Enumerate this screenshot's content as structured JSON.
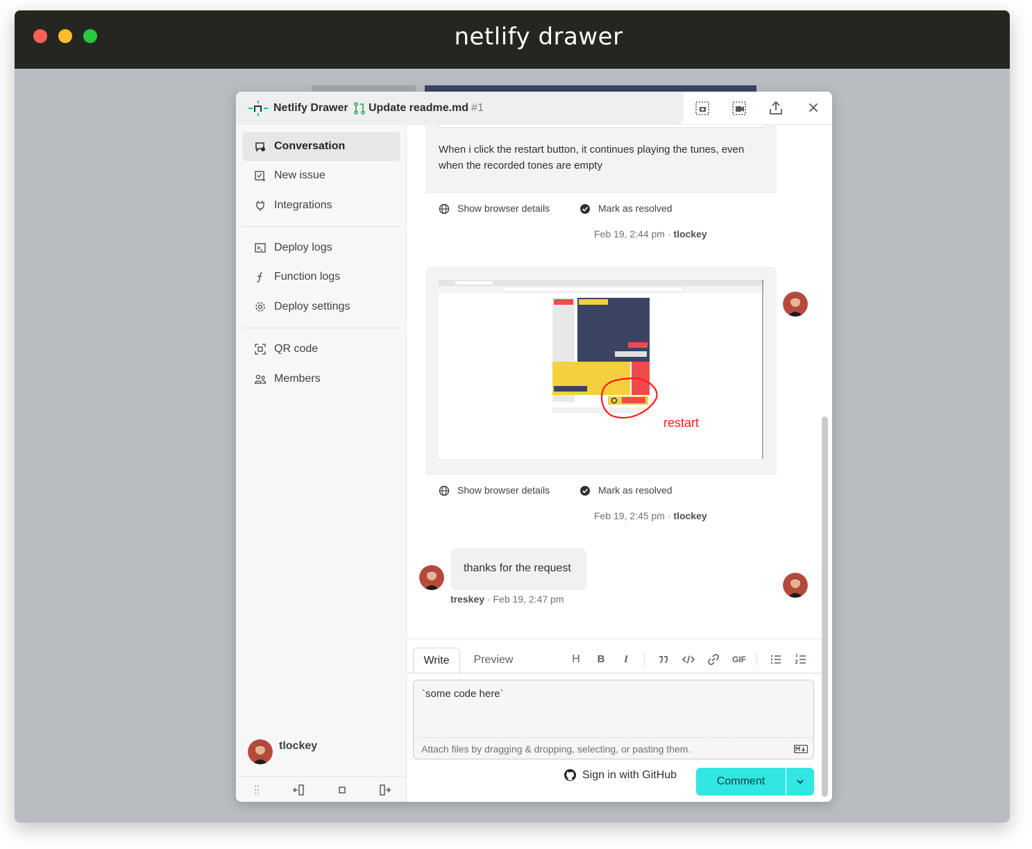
{
  "window": {
    "title": "netlify drawer"
  },
  "header": {
    "brand": "Netlify Drawer",
    "pr_title": "Update readme.md",
    "pr_number": "#1",
    "actions": [
      "screenshot-icon",
      "record-icon",
      "share-icon",
      "close-icon"
    ],
    "close_label": "×"
  },
  "sidebar": {
    "items": [
      {
        "label": "Conversation",
        "icon": "chat-icon",
        "active": true
      },
      {
        "label": "New issue",
        "icon": "new-issue-icon"
      },
      {
        "label": "Integrations",
        "icon": "plug-icon"
      },
      {
        "label": "Deploy logs",
        "icon": "terminal-icon"
      },
      {
        "label": "Function logs",
        "icon": "function-icon"
      },
      {
        "label": "Deploy settings",
        "icon": "gear-icon"
      },
      {
        "label": "QR code",
        "icon": "qr-icon"
      },
      {
        "label": "Members",
        "icon": "members-icon"
      }
    ],
    "user": {
      "name": "tlockey"
    },
    "footer_icons": [
      "drag-handle-icon",
      "dock-left-icon",
      "float-icon",
      "dock-right-icon"
    ]
  },
  "conversation": {
    "card1": {
      "text": "When i click the restart button, it continues playing the tunes, even when the recorded tones are empty",
      "browser_details": "Show browser details",
      "resolve": "Mark as resolved",
      "timestamp": "Feb 19, 2:44 pm",
      "author": "tlockey"
    },
    "card2": {
      "annotation": "restart",
      "browser_details": "Show browser details",
      "resolve": "Mark as resolved",
      "timestamp": "Feb 19, 2:45 pm",
      "author": "tlockey"
    },
    "reply": {
      "text": "thanks for the request",
      "author": "treskey",
      "timestamp": "Feb 19, 2:47 pm"
    },
    "separator": "·"
  },
  "composer": {
    "tabs": [
      "Write",
      "Preview"
    ],
    "active_tab": "Write",
    "toolbar": [
      "H",
      "B",
      "I",
      "quote-icon",
      "code-icon",
      "link-icon",
      "GIF",
      "bullet-list-icon",
      "numbered-list-icon"
    ],
    "value": "`some code here`",
    "hint": "Attach files by dragging & dropping, selecting, or pasting them.",
    "github_signin": "Sign in with GitHub",
    "submit_label": "Comment"
  },
  "colors": {
    "accent": "#32e6e2",
    "titlebar": "#262621",
    "annotation": "#ff1a1a"
  }
}
